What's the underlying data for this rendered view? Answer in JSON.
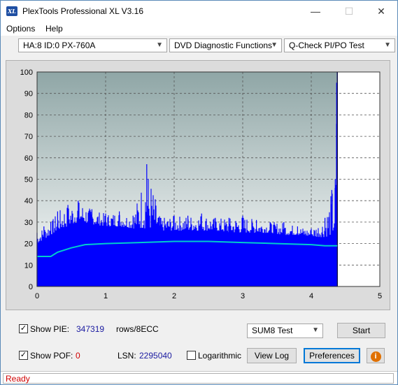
{
  "window": {
    "title": "PlexTools Professional XL V3.16",
    "icon_text": "XL",
    "controls": {
      "minimize": "—",
      "maximize": "☐",
      "close": "✕"
    }
  },
  "menu": {
    "options": "Options",
    "help": "Help"
  },
  "toolbar": {
    "drive": "HA:8 ID:0  PX-760A",
    "function": "DVD Diagnostic Functions",
    "test": "Q-Check PI/PO Test"
  },
  "chart_data": {
    "type": "bar",
    "xlim": [
      0,
      5
    ],
    "ylim": [
      0,
      100
    ],
    "x_ticks": [
      "0",
      "1",
      "2",
      "3",
      "4",
      "5"
    ],
    "y_ticks": [
      "0",
      "10",
      "20",
      "30",
      "40",
      "50",
      "60",
      "70",
      "80",
      "90",
      "100"
    ],
    "grid": true,
    "data_end_x": 4.38,
    "series": [
      {
        "kind": "pie_bars",
        "color": "#0000ff",
        "x": [
          0.0,
          0.1,
          0.2,
          0.3,
          0.45,
          0.6,
          0.8,
          1.0,
          1.2,
          1.4,
          1.6,
          1.8,
          2.0,
          2.2,
          2.4,
          2.6,
          2.8,
          3.0,
          3.2,
          3.4,
          3.6,
          3.8,
          4.0,
          4.2,
          4.3,
          4.35,
          4.37,
          4.38
        ],
        "y": [
          25,
          28,
          30,
          35,
          38,
          40,
          36,
          34,
          35,
          33,
          57,
          32,
          33,
          33,
          34,
          32,
          32,
          33,
          31,
          30,
          30,
          28,
          27,
          32,
          45,
          50,
          95,
          100
        ],
        "baseline": [
          20,
          22,
          24,
          26,
          28,
          30,
          29,
          28,
          28,
          27,
          27,
          26,
          26,
          26,
          26,
          26,
          25,
          25,
          25,
          25,
          24,
          24,
          23,
          23,
          24,
          24,
          24,
          24
        ]
      },
      {
        "kind": "pie_sum8_line",
        "color": "#00cccc",
        "x": [
          0.0,
          0.1,
          0.2,
          0.3,
          0.5,
          0.7,
          1.0,
          1.5,
          2.0,
          2.5,
          3.0,
          3.5,
          4.0,
          4.2,
          4.38
        ],
        "y": [
          14,
          14,
          14,
          16,
          18,
          19.5,
          20,
          20.5,
          21,
          21,
          20.5,
          20,
          19.5,
          19,
          19
        ]
      }
    ]
  },
  "bottom": {
    "show_pie_label": "Show PIE:",
    "pie_value": "347319",
    "pie_unit": "rows/8ECC",
    "show_pof_label": "Show POF:",
    "pof_value": "0",
    "lsn_label": "LSN:",
    "lsn_value": "2295040",
    "logarithmic_label": "Logarithmic",
    "sum_select": "SUM8 Test",
    "start_label": "Start",
    "view_log_label": "View Log",
    "preferences_label": "Preferences",
    "info_icon": "i",
    "show_pie_checked": "✓",
    "show_pof_checked": "✓"
  },
  "status": {
    "text": "Ready"
  },
  "colors": {
    "plot_bg_top": "#8da4a4",
    "plot_bg_bottom": "#ffffff",
    "pie_bars": "#0000ff",
    "sum_line": "#00cccc",
    "status_red": "#d00000"
  }
}
